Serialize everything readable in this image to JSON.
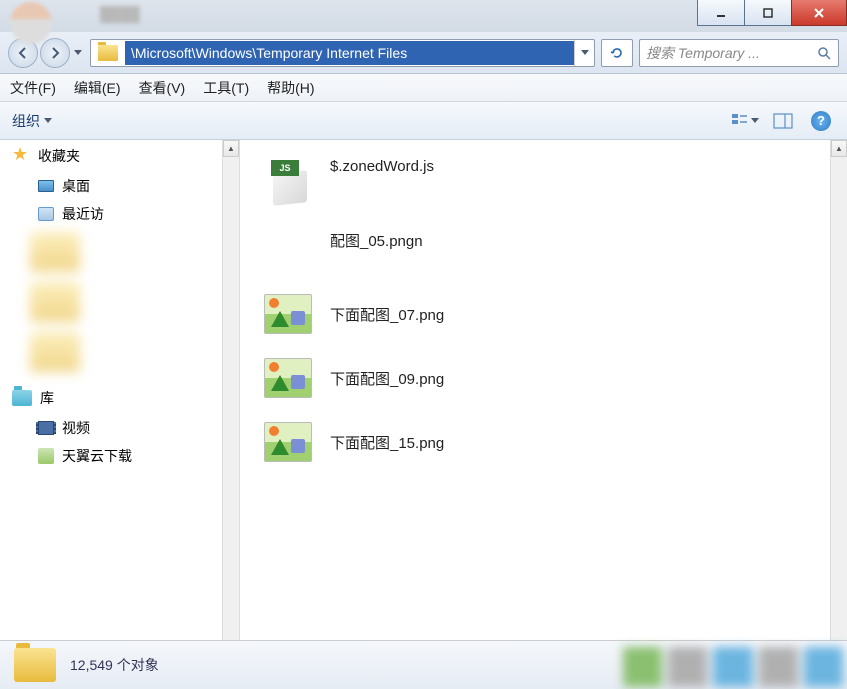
{
  "window": {
    "minimize_icon": "minimize",
    "maximize_icon": "maximize",
    "close_icon": "close"
  },
  "nav": {
    "path": "\\Microsoft\\Windows\\Temporary Internet Files",
    "search_placeholder": "搜索 Temporary ..."
  },
  "menu": {
    "file": "文件(F)",
    "edit": "编辑(E)",
    "view": "查看(V)",
    "tools": "工具(T)",
    "help": "帮助(H)"
  },
  "toolbar": {
    "organize": "组织",
    "view_icon": "view-options",
    "preview_icon": "preview-pane",
    "help_symbol": "?"
  },
  "sidebar": {
    "favorites_label": "收藏夹",
    "desktop": "桌面",
    "recent": "最近访",
    "libraries_label": "库",
    "videos": "视频",
    "tianyi_dl": "天翼云下载"
  },
  "files": [
    {
      "name": "$.zonedWord.js",
      "type": "js"
    },
    {
      "name": "配图_05.pngn",
      "type": "none"
    },
    {
      "name": "下面配图_07.png",
      "type": "image"
    },
    {
      "name": "下面配图_09.png",
      "type": "image"
    },
    {
      "name": "下面配图_15.png",
      "type": "image"
    }
  ],
  "status": {
    "count_text": "12,549 个对象"
  }
}
